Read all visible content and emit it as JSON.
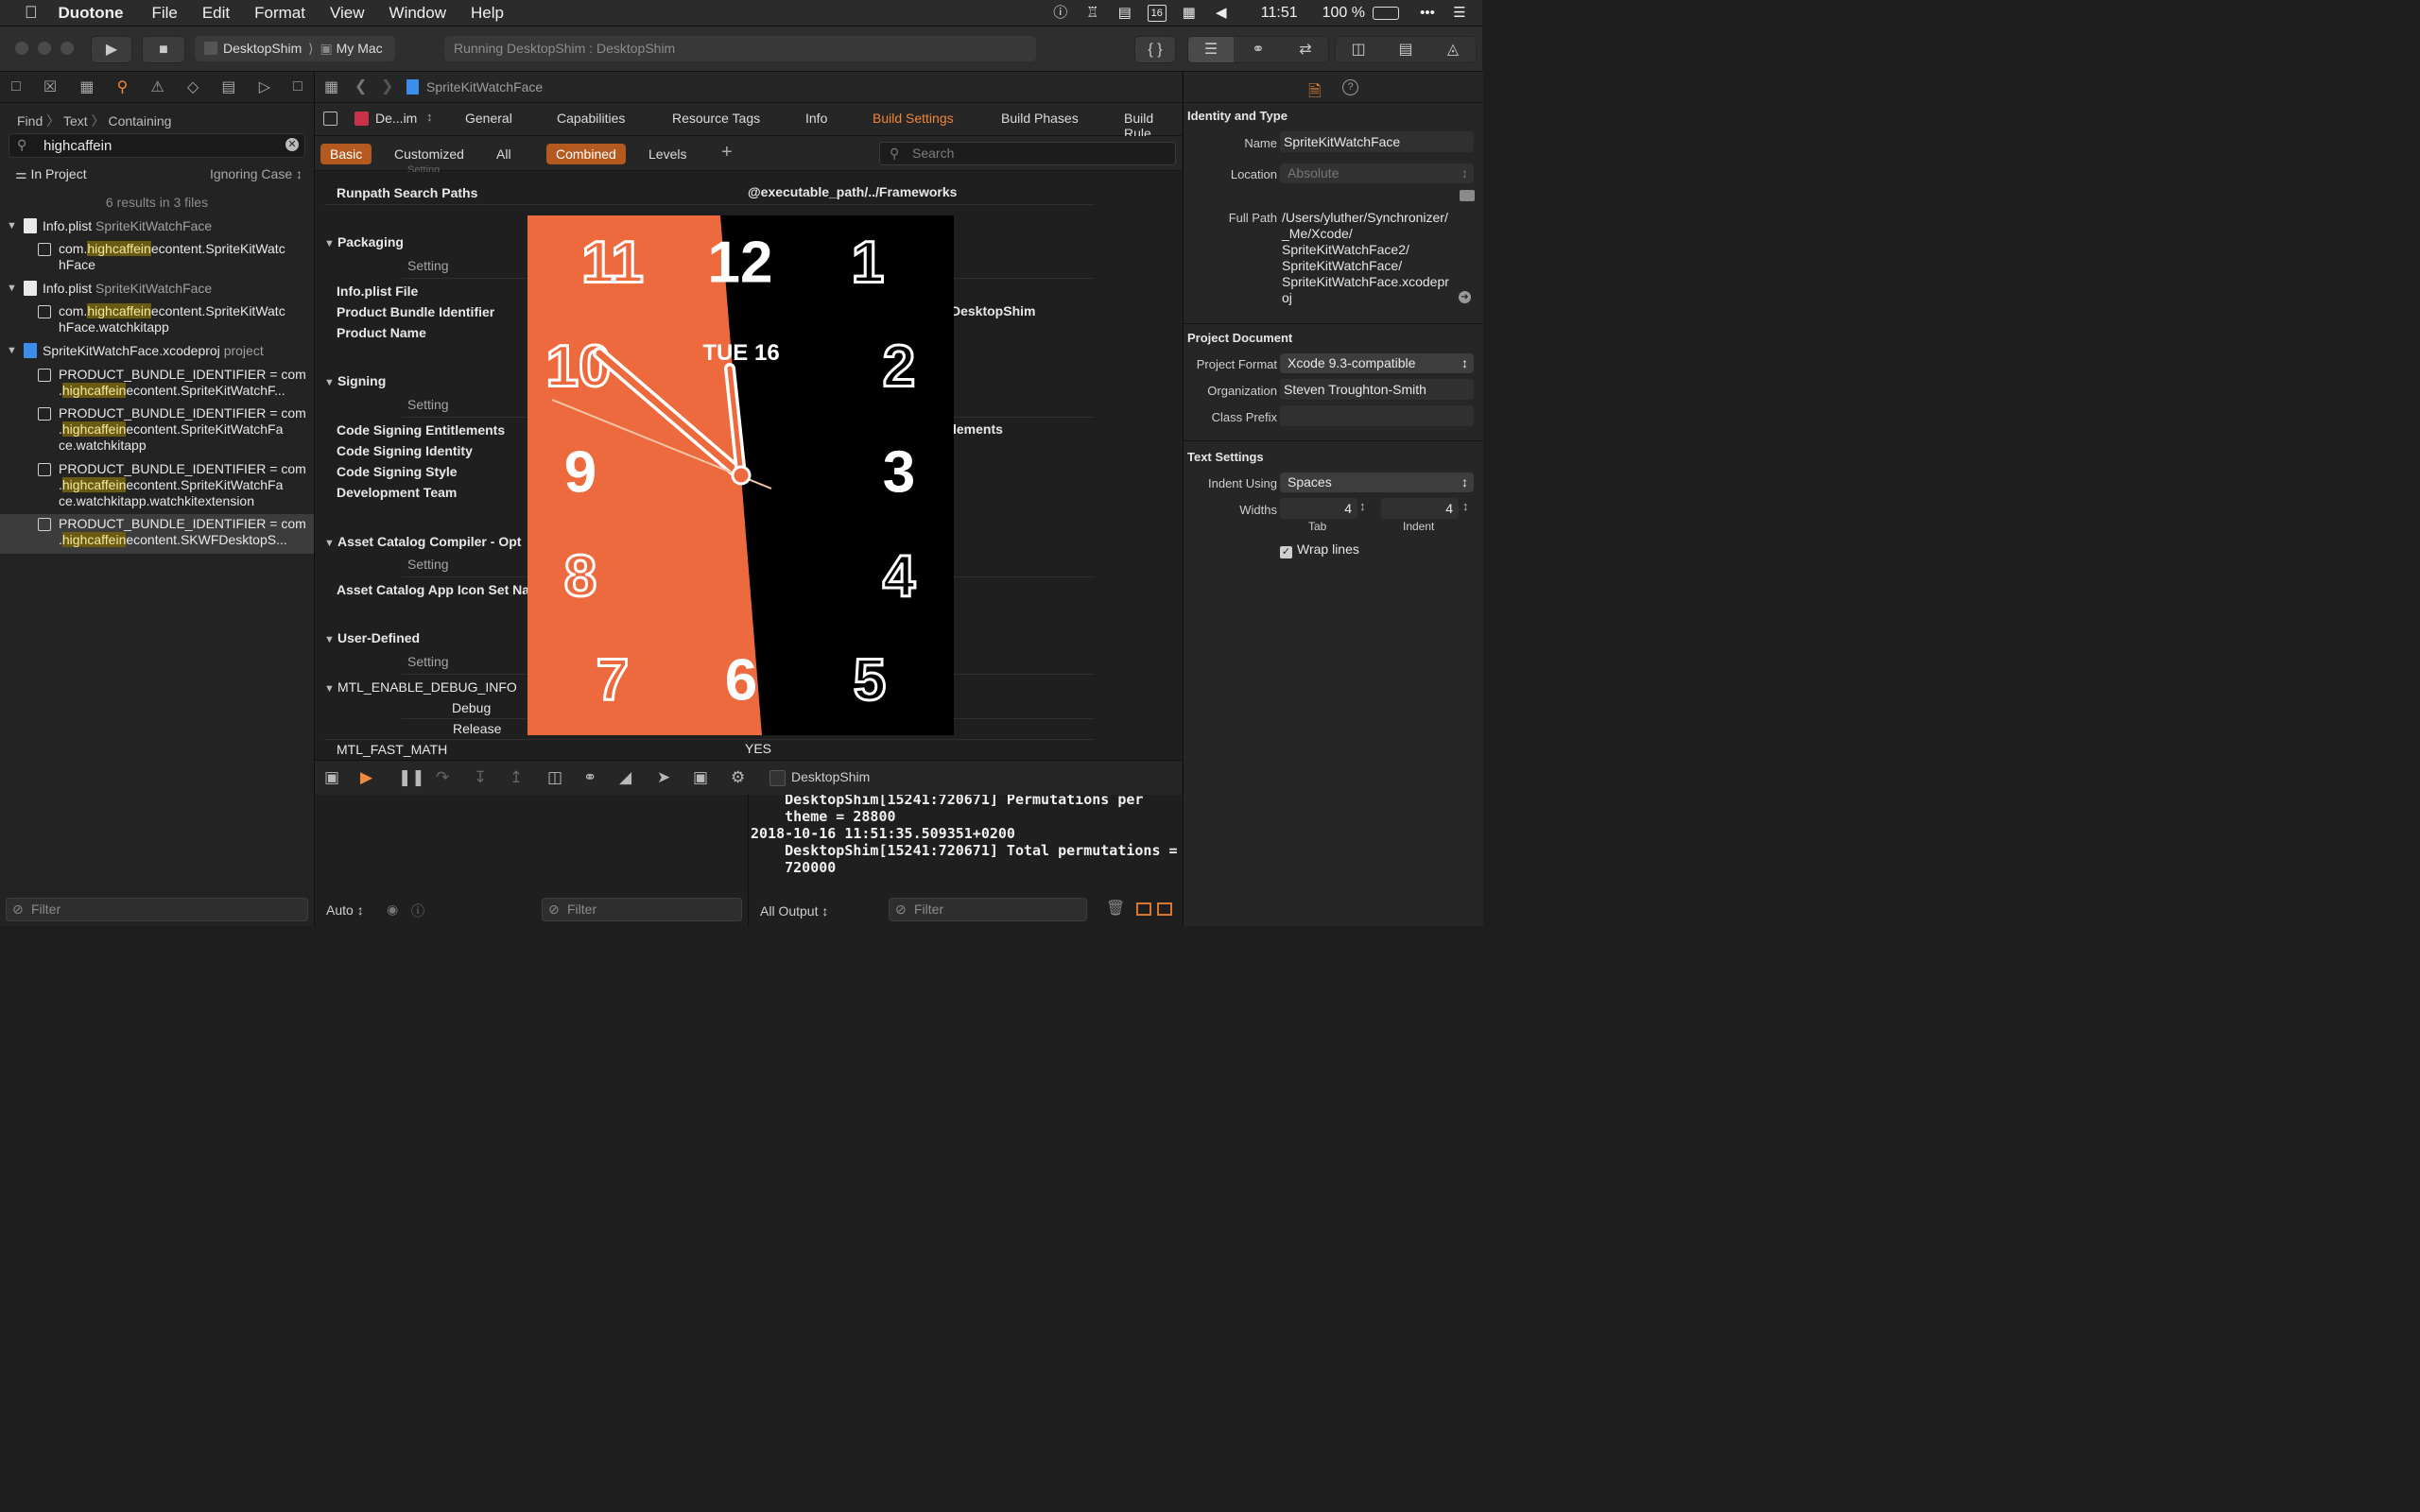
{
  "menubar": {
    "app": "Duotone",
    "items": [
      "File",
      "Edit",
      "Format",
      "View",
      "Window",
      "Help"
    ],
    "calendar_day": "16",
    "clock": "11:51",
    "battery": "100 %"
  },
  "toolbar": {
    "scheme": "DesktopShim",
    "destination": "My Mac",
    "activity": "Running DesktopShim : DesktopShim"
  },
  "navigator": {
    "path": [
      "Find",
      "Text",
      "Containing"
    ],
    "query": "highcaffein",
    "scope": "In Project",
    "case": "Ignoring Case",
    "summary": "6 results in 3 files",
    "filter_placeholder": "Filter",
    "groups": [
      {
        "file": "Info.plist",
        "sub": "SpriteKitWatchFace"
      },
      {
        "file": "Info.plist",
        "sub": "SpriteKitWatchFace"
      },
      {
        "file": "SpriteKitWatchFace.xcodeproj",
        "sub": "project"
      }
    ],
    "hits": [
      {
        "pre": "com.",
        "match": "highcaffein",
        "post": "econtent.SpriteKitWatc",
        "line2": "hFace"
      },
      {
        "pre": "com.",
        "match": "highcaffein",
        "post": "econtent.SpriteKitWatc",
        "line2": "hFace.watchkitapp"
      },
      {
        "line1": "PRODUCT_BUNDLE_IDENTIFIER = com",
        "pre": ".",
        "match": "highcaffein",
        "post": "econtent.SpriteKitWatchF..."
      },
      {
        "line1": "PRODUCT_BUNDLE_IDENTIFIER = com",
        "pre": ".",
        "match": "highcaffein",
        "post": "econtent.SpriteKitWatchFa",
        "line3": "ce.watchkitapp"
      },
      {
        "line1": "PRODUCT_BUNDLE_IDENTIFIER = com",
        "pre": ".",
        "match": "highcaffein",
        "post": "econtent.SpriteKitWatchFa",
        "line3": "ce.watchkitapp.watchkitextension"
      },
      {
        "line1": "PRODUCT_BUNDLE_IDENTIFIER = com",
        "pre": ".",
        "match": "highcaffein",
        "post": "econtent.SKWFDesktopS..."
      }
    ]
  },
  "editor": {
    "jump_title": "SpriteKitWatchFace",
    "target": "De...im",
    "tabs": [
      "General",
      "Capabilities",
      "Resource Tags",
      "Info",
      "Build Settings",
      "Build Phases",
      "Build Rule"
    ],
    "filters": [
      "Basic",
      "Customized",
      "All",
      "Combined",
      "Levels"
    ],
    "search_placeholder": "Search",
    "partial_top": "Setting",
    "runpath_label": "Runpath Search Paths",
    "runpath_value": "@executable_path/../Frameworks",
    "sections": {
      "packaging": "Packaging",
      "signing": "Signing",
      "asset": "Asset Catalog Compiler - Opt",
      "user": "User-Defined"
    },
    "setting_header": "Setting",
    "packaging_rows": [
      "Info.plist File",
      "Product Bundle Identifier",
      "Product Name"
    ],
    "bundle_value_tail": "DesktopShim",
    "signing_rows": [
      "Code Signing Entitlements",
      "Code Signing Identity",
      "Code Signing Style",
      "Development Team"
    ],
    "entitlements_tail": "lements",
    "asset_row": "Asset Catalog App Icon Set Na",
    "mtl_debug": "MTL_ENABLE_DEBUG_INFO",
    "debug": "Debug",
    "release": "Release",
    "mtl_fast": "MTL_FAST_MATH",
    "mtl_fast_value": "YES"
  },
  "watchface": {
    "date": "TUE 16",
    "numerals": [
      "12",
      "1",
      "2",
      "3",
      "4",
      "5",
      "6",
      "7",
      "8",
      "9",
      "10",
      "11"
    ],
    "colors": {
      "left": "#ec6a3e",
      "right": "#000000"
    }
  },
  "debug": {
    "process": "DesktopShim",
    "auto": "Auto",
    "filter": "Filter",
    "output": "All Output",
    "console": "    DesktopShim[15241:720671] Permutations per\n    theme = 28800\n2018-10-16 11:51:35.509351+0200\n    DesktopShim[15241:720671] Total permutations =\n    720000"
  },
  "inspector": {
    "identity_title": "Identity and Type",
    "name_label": "Name",
    "name_value": "SpriteKitWatchFace",
    "location_label": "Location",
    "location_value": "Absolute",
    "fullpath_label": "Full Path",
    "fullpath_lines": [
      "/Users/yluther/Synchronizer/",
      "_Me/Xcode/",
      "SpriteKitWatchFace2/",
      "SpriteKitWatchFace/",
      "SpriteKitWatchFace.xcodepr",
      "oj"
    ],
    "projdoc_title": "Project Document",
    "format_label": "Project Format",
    "format_value": "Xcode 9.3-compatible",
    "org_label": "Organization",
    "org_value": "Steven Troughton-Smith",
    "prefix_label": "Class Prefix",
    "text_title": "Text Settings",
    "indent_label": "Indent Using",
    "indent_value": "Spaces",
    "widths_label": "Widths",
    "tab_value": "4",
    "indent_width": "4",
    "tab_label": "Tab",
    "indent_label2": "Indent",
    "wrap_label": "Wrap lines"
  }
}
